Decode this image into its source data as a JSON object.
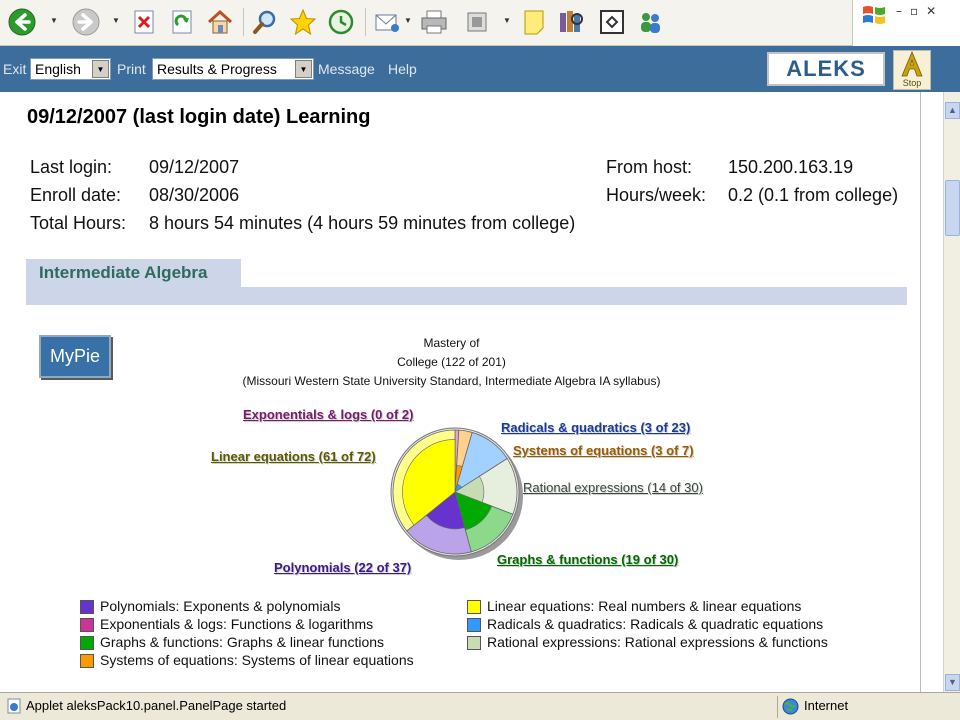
{
  "menubar": {
    "exit": "Exit",
    "language": "English",
    "print": "Print",
    "print_option": "Results & Progress",
    "message": "Message",
    "help": "Help",
    "logo": "ALEKS",
    "stop": "Stop"
  },
  "page_title": "09/12/2007 (last login date) Learning",
  "info": {
    "last_login_label": "Last login:",
    "last_login": "09/12/2007",
    "enroll_label": "Enroll date:",
    "enroll": "08/30/2006",
    "total_label": "Total Hours:",
    "total": "8 hours 54 minutes (4 hours 59 minutes from college)",
    "host_label": "From host:",
    "host": "150.200.163.19",
    "hpw_label": "Hours/week:",
    "hpw": "0.2 (0.1 from college)"
  },
  "course": "Intermediate Algebra",
  "mypie": "MyPie",
  "chart_caption": {
    "line1": "Mastery of",
    "line2": "College (122 of 201)",
    "line3": "(Missouri Western State University Standard, Intermediate Algebra IA syllabus)"
  },
  "chart_data": {
    "type": "pie",
    "slices": [
      {
        "name": "Exponentials & logs",
        "label": "Exponentials & logs (0 of 2)",
        "mastered": 0,
        "total": 2,
        "color": "#cc3399"
      },
      {
        "name": "Systems of equations",
        "label": "Systems of equations (3 of 7)",
        "mastered": 3,
        "total": 7,
        "color": "#ff9900"
      },
      {
        "name": "Radicals & quadratics",
        "label": "Radicals & quadratics (3 of 23)",
        "mastered": 3,
        "total": 23,
        "color": "#3399ff"
      },
      {
        "name": "Rational expressions",
        "label": "Rational expressions (14 of 30)",
        "mastered": 14,
        "total": 30,
        "color": "#c8dcb4"
      },
      {
        "name": "Graphs & functions",
        "label": "Graphs & functions (19 of 30)",
        "mastered": 19,
        "total": 30,
        "color": "#00aa00"
      },
      {
        "name": "Polynomials",
        "label": "Polynomials (22 of 37)",
        "mastered": 22,
        "total": 37,
        "color": "#6633cc"
      },
      {
        "name": "Linear equations",
        "label": "Linear equations (61 of 72)",
        "mastered": 61,
        "total": 72,
        "color": "#ffff00"
      }
    ]
  },
  "legend": [
    {
      "text": "Polynomials: Exponents & polynomials",
      "color": "#6633cc"
    },
    {
      "text": "Exponentials & logs: Functions & logarithms",
      "color": "#cc3399"
    },
    {
      "text": "Graphs & functions: Graphs & linear functions",
      "color": "#00aa00"
    },
    {
      "text": "Systems of equations: Systems of linear equations",
      "color": "#ff9900"
    },
    {
      "text": "Linear equations: Real numbers & linear equations",
      "color": "#ffff00"
    },
    {
      "text": "Radicals & quadratics: Radicals & quadratic equations",
      "color": "#3399ff"
    },
    {
      "text": "Rational expressions: Rational expressions & functions",
      "color": "#c8dcb4"
    }
  ],
  "status": {
    "message": "Applet aleksPack10.panel.PanelPage started",
    "zone": "Internet"
  },
  "icons": [
    "back-icon",
    "forward-icon",
    "stop-icon",
    "refresh-icon",
    "home-icon",
    "search-icon",
    "favorites-icon",
    "history-icon",
    "mail-icon",
    "print-icon",
    "fullscreen-icon",
    "notes-icon",
    "research-icon",
    "edit-icon",
    "messenger-icon"
  ]
}
